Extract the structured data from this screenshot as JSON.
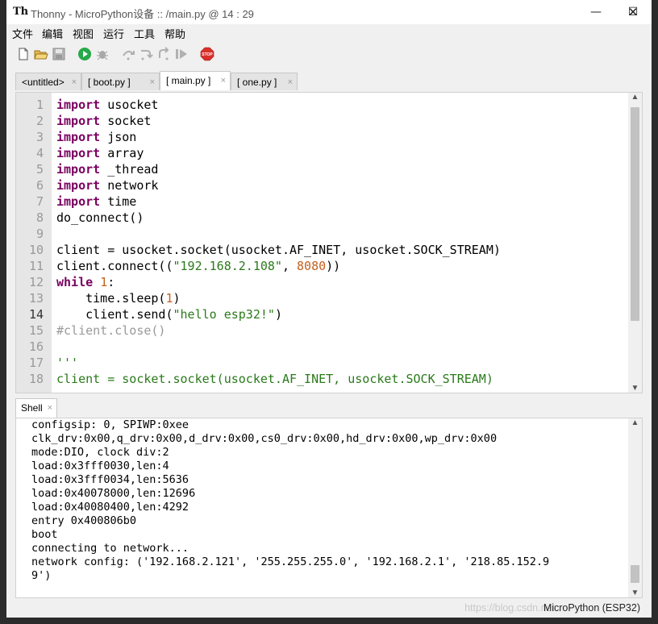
{
  "window": {
    "title": "Thonny  -  MicroPython设备 :: /main.py  @  14 : 29",
    "controls": {
      "minimize": "—",
      "maximize": "☐",
      "close": "✕"
    }
  },
  "menu": [
    "文件",
    "编辑",
    "视图",
    "运行",
    "工具",
    "帮助"
  ],
  "toolbar": {
    "icons": [
      "new-file-icon",
      "open-file-icon",
      "save-icon",
      "run-icon",
      "debug-icon",
      "step-over-icon",
      "step-into-icon",
      "step-out-icon",
      "resume-icon",
      "stop-icon"
    ],
    "stop_label": "STOP"
  },
  "tabs": [
    {
      "label": "<untitled>",
      "active": false
    },
    {
      "label": "[ boot.py ]",
      "active": false
    },
    {
      "label": "[ main.py ]",
      "active": true
    },
    {
      "label": "[ one.py ]",
      "active": false
    }
  ],
  "tab_close": "×",
  "editor": {
    "current_line": 14,
    "lines": [
      {
        "n": "1",
        "tokens": [
          {
            "t": "import",
            "c": "kw"
          },
          {
            "t": " usocket"
          }
        ]
      },
      {
        "n": "2",
        "tokens": [
          {
            "t": "import",
            "c": "kw"
          },
          {
            "t": " socket"
          }
        ]
      },
      {
        "n": "3",
        "tokens": [
          {
            "t": "import",
            "c": "kw"
          },
          {
            "t": " json"
          }
        ]
      },
      {
        "n": "4",
        "tokens": [
          {
            "t": "import",
            "c": "kw"
          },
          {
            "t": " array"
          }
        ]
      },
      {
        "n": "5",
        "tokens": [
          {
            "t": "import",
            "c": "kw"
          },
          {
            "t": " _thread"
          }
        ]
      },
      {
        "n": "6",
        "tokens": [
          {
            "t": "import",
            "c": "kw"
          },
          {
            "t": " network"
          }
        ]
      },
      {
        "n": "7",
        "tokens": [
          {
            "t": "import",
            "c": "kw"
          },
          {
            "t": " time"
          }
        ]
      },
      {
        "n": "8",
        "tokens": [
          {
            "t": "do_connect()"
          }
        ]
      },
      {
        "n": "9",
        "tokens": []
      },
      {
        "n": "10",
        "tokens": [
          {
            "t": "client = usocket.socket(usocket.AF_INET, usocket.SOCK_STREAM)"
          }
        ]
      },
      {
        "n": "11",
        "tokens": [
          {
            "t": "client.connect(("
          },
          {
            "t": "\"192.168.2.108\"",
            "c": "str"
          },
          {
            "t": ", "
          },
          {
            "t": "8080",
            "c": "num"
          },
          {
            "t": "))"
          }
        ]
      },
      {
        "n": "12",
        "tokens": [
          {
            "t": "while",
            "c": "kw"
          },
          {
            "t": " "
          },
          {
            "t": "1",
            "c": "num"
          },
          {
            "t": ":"
          }
        ]
      },
      {
        "n": "13",
        "tokens": [
          {
            "t": "    time.sleep("
          },
          {
            "t": "1",
            "c": "num"
          },
          {
            "t": ")"
          }
        ]
      },
      {
        "n": "14",
        "tokens": [
          {
            "t": "    client.send("
          },
          {
            "t": "\"hello esp32!\"",
            "c": "str"
          },
          {
            "t": ")"
          }
        ]
      },
      {
        "n": "15",
        "tokens": [
          {
            "t": "#client.close()",
            "c": "com"
          }
        ]
      },
      {
        "n": "16",
        "tokens": []
      },
      {
        "n": "17",
        "tokens": [
          {
            "t": "'''",
            "c": "docstr"
          }
        ]
      },
      {
        "n": "18",
        "tokens": [
          {
            "t": "client = socket.socket(usocket.AF_INET, usocket.SOCK_STREAM)",
            "c": "docstr"
          }
        ]
      }
    ]
  },
  "shell": {
    "tab_label": "Shell",
    "lines": [
      "configsip: 0, SPIWP:0xee",
      "clk_drv:0x00,q_drv:0x00,d_drv:0x00,cs0_drv:0x00,hd_drv:0x00,wp_drv:0x00",
      "mode:DIO, clock div:2",
      "load:0x3fff0030,len:4",
      "load:0x3fff0034,len:5636",
      "load:0x40078000,len:12696",
      "load:0x40080400,len:4292",
      "entry 0x400806b0",
      "boot",
      "connecting to network...",
      "network config: ('192.168.2.121', '255.255.255.0', '192.168.2.1', '218.85.152.9",
      "9')"
    ]
  },
  "status": {
    "interpreter": "MicroPython (ESP32)",
    "watermark": "https://blog.csdn.net"
  }
}
